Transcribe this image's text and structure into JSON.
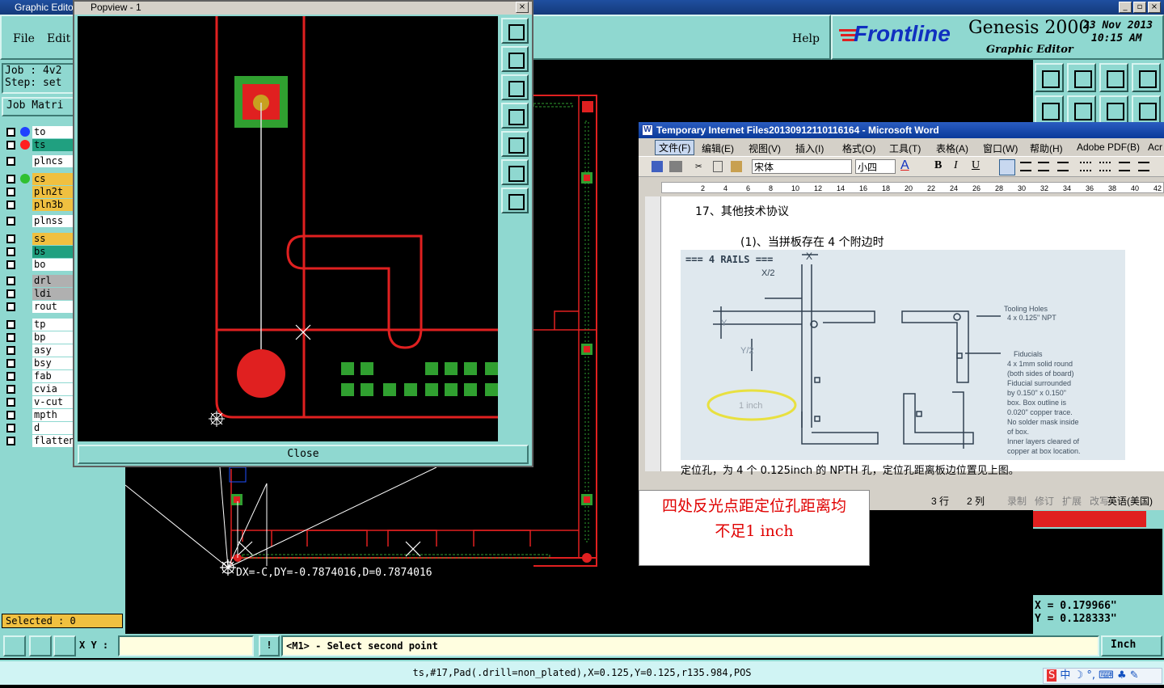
{
  "app": {
    "title": "Graphic Editor",
    "menu": [
      "File",
      "Edit"
    ],
    "help_label": "Help",
    "brand": "Frontline",
    "product": "Genesis 2000",
    "subtitle": "Graphic Editor",
    "date": "23 Nov 2013",
    "time": "10:15 AM",
    "job_label": "Job : 4v2",
    "step_label": "Step: set",
    "job_matrix_label": "Job Matri",
    "selected": "Selected : 0"
  },
  "layers": [
    {
      "name": "to",
      "color": "#ffffff",
      "dot": "#2040ff"
    },
    {
      "name": "ts",
      "color": "#20a080",
      "dot": "#ff2020"
    },
    {
      "name": "plncs",
      "color": "#ffffff",
      "dot": ""
    },
    {
      "name": "cs",
      "color": "#f0c040",
      "dot": "#30c030"
    },
    {
      "name": "pln2t",
      "color": "#f0c040",
      "dot": ""
    },
    {
      "name": "pln3b",
      "color": "#f0c040",
      "dot": ""
    },
    {
      "name": "plnss",
      "color": "#ffffff",
      "dot": ""
    },
    {
      "name": "ss",
      "color": "#f0c040",
      "dot": ""
    },
    {
      "name": "bs",
      "color": "#20a080",
      "dot": ""
    },
    {
      "name": "bo",
      "color": "#ffffff",
      "dot": ""
    },
    {
      "name": "drl",
      "color": "#b0b0b0",
      "dot": ""
    },
    {
      "name": "ldi",
      "color": "#b0b0b0",
      "dot": ""
    },
    {
      "name": "rout",
      "color": "#ffffff",
      "dot": ""
    },
    {
      "name": "tp",
      "color": "#ffffff",
      "dot": ""
    },
    {
      "name": "bp",
      "color": "#ffffff",
      "dot": ""
    },
    {
      "name": "asy",
      "color": "#ffffff",
      "dot": ""
    },
    {
      "name": "bsy",
      "color": "#ffffff",
      "dot": ""
    },
    {
      "name": "fab",
      "color": "#ffffff",
      "dot": ""
    },
    {
      "name": "cvia",
      "color": "#ffffff",
      "dot": ""
    },
    {
      "name": "v-cut",
      "color": "#ffffff",
      "dot": ""
    },
    {
      "name": "mpth",
      "color": "#ffffff",
      "dot": ""
    },
    {
      "name": "d",
      "color": "#ffffff",
      "dot": ""
    },
    {
      "name": "flatten",
      "color": "#ffffff",
      "dot": ""
    }
  ],
  "popview": {
    "title": "Popview - 1",
    "close_label": "Close"
  },
  "canvas": {
    "measure": "DX=-C,DY=-0.7874016,D=0.7874016"
  },
  "coords": {
    "x": "X = 0.179966\"",
    "y": "Y = 0.128333\""
  },
  "command": {
    "xy_label": "X Y :",
    "xy_value": "",
    "bang": "!",
    "prompt": "<M1> - Select second point",
    "units": "Inch"
  },
  "status": "ts,#17,Pad(.drill=non_plated),X=0.125,Y=0.125,r135.984,POS",
  "word": {
    "title": "Temporary Internet Files20130912110116164 - Microsoft Word",
    "menu": [
      "文件(F)",
      "编辑(E)",
      "视图(V)",
      "插入(I)",
      "格式(O)",
      "工具(T)",
      "表格(A)",
      "窗口(W)",
      "帮助(H)",
      "Adobe PDF(B)",
      "Acr"
    ],
    "font": "宋体",
    "size": "小四",
    "heading": "17、其他技术协议",
    "para": "(1)、当拼板存在 4 个附边时",
    "figure_title": "=== 4 RAILS ===",
    "fig_x": "X",
    "fig_x2": "X/2",
    "fig_y": "Y",
    "fig_y2": "Y/2",
    "fig_inch": "1 inch",
    "tooling": "Tooling Holes\n4 x 0.125\" NPT",
    "fiducials": "Fiducials\n4 x 1mm solid round\n(both sides of board)\nFiducial surrounded\nby 0.150\" x 0.150\"\nbox. Box outline is\n0.020\" copper trace.\nNo solder mask inside\nof box.\nInner layers cleared of\ncopper at box location.",
    "bottom_text": "定位孔，为 4 个 0.125inch 的 NPTH 孔，定位孔距离板边位置见上图。",
    "status_line": "3 行",
    "status_col": "2 列",
    "status_items": [
      "录制",
      "修订",
      "扩展",
      "改写",
      "英语(美国)"
    ]
  },
  "annotation": {
    "line1": "四处反光点距定位孔距离均",
    "line2": "不足1 inch"
  }
}
